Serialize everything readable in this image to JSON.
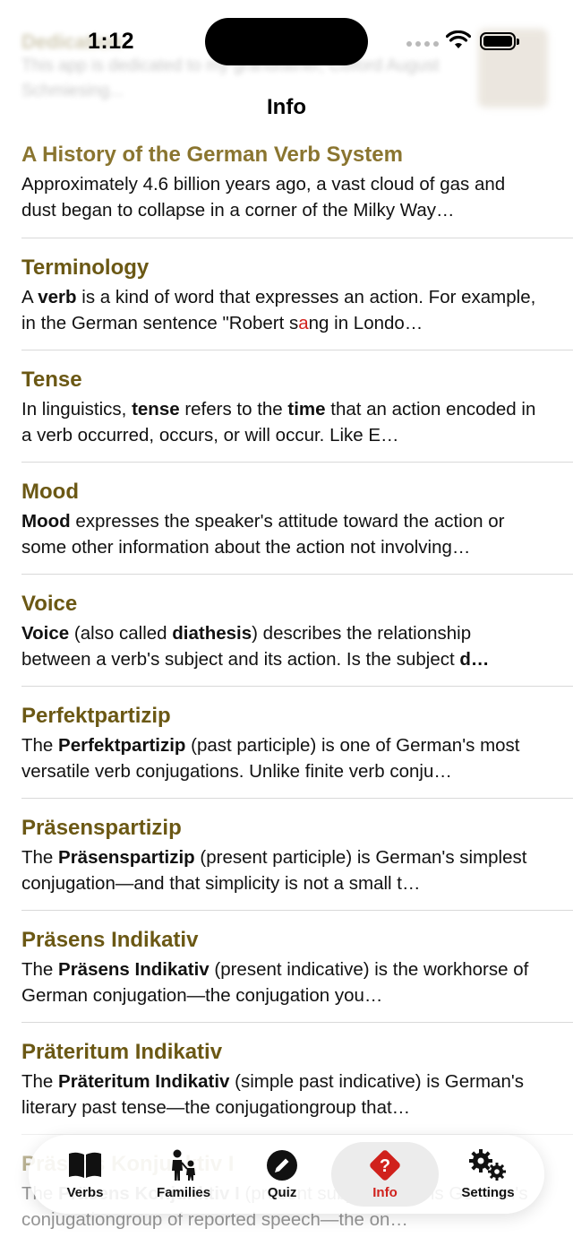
{
  "status_bar": {
    "time": "1:12"
  },
  "header": {
    "title": "Info"
  },
  "ghost_row": {
    "title": "Dedication",
    "desc": "This app is dedicated to my grandfather, Clifford August Schmiesing..."
  },
  "rows": [
    {
      "title": "A History of the German Verb System",
      "desc_html": "Approximately 4.6 billion years ago, a vast cloud of gas and dust began to collapse in a corner of the Milky Way…"
    },
    {
      "title": "Terminology",
      "desc_html": "A <b>verb</b> is a kind of word that expresses an action. For example, in the German sentence \"Robert s<span class=\"red\">a</span>ng in Londo…"
    },
    {
      "title": "Tense",
      "desc_html": "In linguistics, <b>tense</b> refers to the <b>time</b> that an action encoded in a verb occurred, occurs, or will occur. Like E…"
    },
    {
      "title": "Mood",
      "desc_html": "<b>Mood</b> expresses the speaker's attitude toward the action or some other information about the action not involving…"
    },
    {
      "title": "Voice",
      "desc_html": "<b>Voice</b> (also called <b>diathesis</b>) describes the relationship between a verb's subject and its action. Is the subject <b>d…</b>"
    },
    {
      "title": "Perfektpartizip",
      "desc_html": "The <b>Perfektpartizip</b> (past participle) is one of German's most versatile verb conjugations. Unlike finite verb conju…"
    },
    {
      "title": "Präsenspartizip",
      "desc_html": "The <b>Präsenspartizip</b> (present participle) is German's simplest conjugation—and that simplicity is not a small t…"
    },
    {
      "title": "Präsens Indikativ",
      "desc_html": "The <b>Präsens Indikativ</b> (present indicative) is the workhorse of German conjugation—the conjugation you…"
    },
    {
      "title": "Präteritum Indikativ",
      "desc_html": "The <b>Präteritum Indikativ</b> (simple past indicative) is German's literary past tense—the conjugationgroup that…"
    },
    {
      "title": "Präsens Konjunktiv I",
      "desc_html": "The <b>Präsens Konjunktiv I</b> (present subjunctive I) is German's conjugationgroup of reported speech—the on…"
    }
  ],
  "tabs": [
    {
      "label": "Verbs",
      "icon": "book-icon",
      "active": false
    },
    {
      "label": "Families",
      "icon": "family-icon",
      "active": false
    },
    {
      "label": "Quiz",
      "icon": "pencil-circle-icon",
      "active": false
    },
    {
      "label": "Info",
      "icon": "question-diamond-icon",
      "active": true
    },
    {
      "label": "Settings",
      "icon": "gears-icon",
      "active": false
    }
  ],
  "colors": {
    "accent": "#d0211c",
    "title": "#6b5814",
    "first_title": "#8a7530"
  }
}
